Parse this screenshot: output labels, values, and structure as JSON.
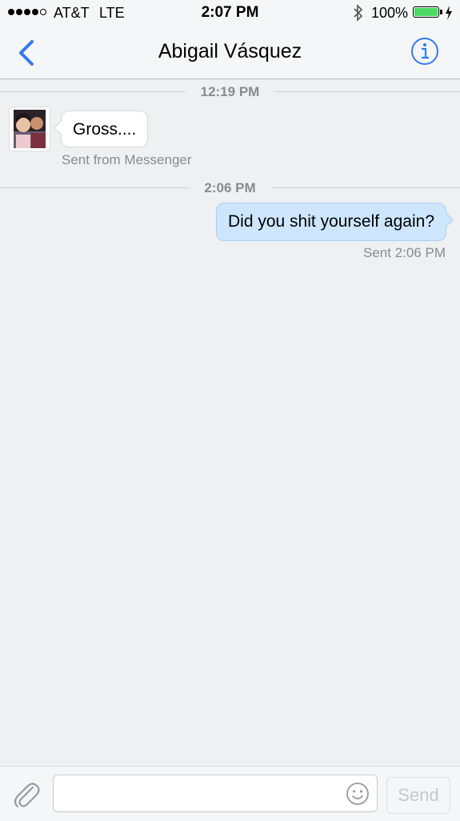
{
  "status_bar": {
    "carrier": "AT&T",
    "network": "LTE",
    "time": "2:07 PM",
    "battery": "100%",
    "signal_bars": 4,
    "signal_max": 5
  },
  "nav": {
    "title": "Abigail Vásquez",
    "back_icon": "chevron-left-icon",
    "info_icon": "info-icon",
    "accent": "#3478f6"
  },
  "messages": {
    "separators": [
      "12:19 PM",
      "2:06 PM"
    ],
    "incoming": {
      "text": "Gross....",
      "meta": "Sent from Messenger"
    },
    "outgoing": {
      "text": "Did you shit yourself again?",
      "meta": "Sent 2:06 PM",
      "bubble_color": "#cde6fe"
    }
  },
  "composer": {
    "placeholder": "",
    "send_label": "Send",
    "attach_icon": "paperclip-icon",
    "emoji_icon": "smiley-icon"
  }
}
